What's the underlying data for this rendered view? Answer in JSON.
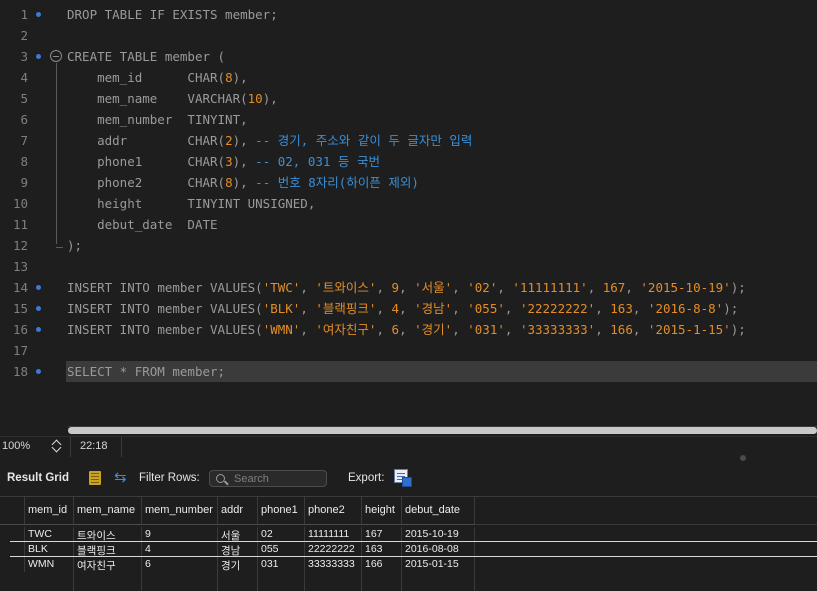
{
  "editor": {
    "lines": [
      {
        "n": "1",
        "dot": true,
        "html": [
          [
            "kw",
            "DROP TABLE IF EXISTS"
          ],
          [
            "pl",
            " member;"
          ]
        ]
      },
      {
        "n": "2",
        "dot": false,
        "html": []
      },
      {
        "n": "3",
        "dot": true,
        "fold": true,
        "html": [
          [
            "kw",
            "CREATE TABLE"
          ],
          [
            "pl",
            " member ("
          ]
        ]
      },
      {
        "n": "4",
        "dot": false,
        "html": [
          [
            "pl",
            "    mem_id      "
          ],
          [
            "ty",
            "CHAR"
          ],
          [
            "pl",
            "("
          ],
          [
            "num",
            "8"
          ],
          [
            "pl",
            "),"
          ]
        ]
      },
      {
        "n": "5",
        "dot": false,
        "html": [
          [
            "pl",
            "    mem_name    "
          ],
          [
            "ty",
            "VARCHAR"
          ],
          [
            "pl",
            "("
          ],
          [
            "num",
            "10"
          ],
          [
            "pl",
            "),"
          ]
        ]
      },
      {
        "n": "6",
        "dot": false,
        "html": [
          [
            "pl",
            "    mem_number  "
          ],
          [
            "ty",
            "TINYINT"
          ],
          [
            "pl",
            ","
          ]
        ]
      },
      {
        "n": "7",
        "dot": false,
        "html": [
          [
            "pl",
            "    addr        "
          ],
          [
            "ty",
            "CHAR"
          ],
          [
            "pl",
            "("
          ],
          [
            "num",
            "2"
          ],
          [
            "pl",
            "), "
          ],
          [
            "cm",
            "-- 경기, 주소와 같이 두 글자만 입력"
          ]
        ]
      },
      {
        "n": "8",
        "dot": false,
        "html": [
          [
            "pl",
            "    phone1      "
          ],
          [
            "ty",
            "CHAR"
          ],
          [
            "pl",
            "("
          ],
          [
            "num",
            "3"
          ],
          [
            "pl",
            "), "
          ],
          [
            "cm",
            "-- 02, 031 등 국번"
          ]
        ]
      },
      {
        "n": "9",
        "dot": false,
        "html": [
          [
            "pl",
            "    phone2      "
          ],
          [
            "ty",
            "CHAR"
          ],
          [
            "pl",
            "("
          ],
          [
            "num",
            "8"
          ],
          [
            "pl",
            "), "
          ],
          [
            "cm",
            "-- 번호 8자리(하이픈 제외)"
          ]
        ]
      },
      {
        "n": "10",
        "dot": false,
        "html": [
          [
            "pl",
            "    height      "
          ],
          [
            "ty",
            "TINYINT UNSIGNED"
          ],
          [
            "pl",
            ","
          ]
        ]
      },
      {
        "n": "11",
        "dot": false,
        "html": [
          [
            "pl",
            "    debut_date  "
          ],
          [
            "ty",
            "DATE"
          ]
        ]
      },
      {
        "n": "12",
        "dot": false,
        "foldEnd": true,
        "html": [
          [
            "pl",
            ");"
          ]
        ]
      },
      {
        "n": "13",
        "dot": false,
        "html": []
      },
      {
        "n": "14",
        "dot": true,
        "html": [
          [
            "kw",
            "INSERT INTO"
          ],
          [
            "pl",
            " member "
          ],
          [
            "kw",
            "VALUES"
          ],
          [
            "pl",
            "("
          ],
          [
            "str",
            "'TWC'"
          ],
          [
            "pl",
            ", "
          ],
          [
            "str",
            "'트와이스'"
          ],
          [
            "pl",
            ", "
          ],
          [
            "num",
            "9"
          ],
          [
            "pl",
            ", "
          ],
          [
            "str",
            "'서울'"
          ],
          [
            "pl",
            ", "
          ],
          [
            "str",
            "'02'"
          ],
          [
            "pl",
            ", "
          ],
          [
            "str",
            "'11111111'"
          ],
          [
            "pl",
            ", "
          ],
          [
            "num",
            "167"
          ],
          [
            "pl",
            ", "
          ],
          [
            "str",
            "'2015-10-19'"
          ],
          [
            "pl",
            ");"
          ]
        ]
      },
      {
        "n": "15",
        "dot": true,
        "html": [
          [
            "kw",
            "INSERT INTO"
          ],
          [
            "pl",
            " member "
          ],
          [
            "kw",
            "VALUES"
          ],
          [
            "pl",
            "("
          ],
          [
            "str",
            "'BLK'"
          ],
          [
            "pl",
            ", "
          ],
          [
            "str",
            "'블랙핑크'"
          ],
          [
            "pl",
            ", "
          ],
          [
            "num",
            "4"
          ],
          [
            "pl",
            ", "
          ],
          [
            "str",
            "'경남'"
          ],
          [
            "pl",
            ", "
          ],
          [
            "str",
            "'055'"
          ],
          [
            "pl",
            ", "
          ],
          [
            "str",
            "'22222222'"
          ],
          [
            "pl",
            ", "
          ],
          [
            "num",
            "163"
          ],
          [
            "pl",
            ", "
          ],
          [
            "str",
            "'2016-8-8'"
          ],
          [
            "pl",
            ");"
          ]
        ]
      },
      {
        "n": "16",
        "dot": true,
        "html": [
          [
            "kw",
            "INSERT INTO"
          ],
          [
            "pl",
            " member "
          ],
          [
            "kw",
            "VALUES"
          ],
          [
            "pl",
            "("
          ],
          [
            "str",
            "'WMN'"
          ],
          [
            "pl",
            ", "
          ],
          [
            "str",
            "'여자친구'"
          ],
          [
            "pl",
            ", "
          ],
          [
            "num",
            "6"
          ],
          [
            "pl",
            ", "
          ],
          [
            "str",
            "'경기'"
          ],
          [
            "pl",
            ", "
          ],
          [
            "str",
            "'031'"
          ],
          [
            "pl",
            ", "
          ],
          [
            "str",
            "'33333333'"
          ],
          [
            "pl",
            ", "
          ],
          [
            "num",
            "166"
          ],
          [
            "pl",
            ", "
          ],
          [
            "str",
            "'2015-1-15'"
          ],
          [
            "pl",
            ");"
          ]
        ]
      },
      {
        "n": "17",
        "dot": false,
        "html": []
      },
      {
        "n": "18",
        "dot": true,
        "current": true,
        "html": [
          [
            "kw",
            "SELECT"
          ],
          [
            "pl",
            " * "
          ],
          [
            "kw",
            "FROM"
          ],
          [
            "pl",
            " member;"
          ]
        ]
      }
    ]
  },
  "status": {
    "zoom": "100%",
    "cursor": "22:18"
  },
  "result_toolbar": {
    "result_grid_label": "Result Grid",
    "filter_rows_label": "Filter Rows:",
    "search_placeholder": "Search",
    "export_label": "Export:"
  },
  "grid": {
    "columns": [
      "mem_id",
      "mem_name",
      "mem_number",
      "addr",
      "phone1",
      "phone2",
      "height",
      "debut_date"
    ],
    "rows": [
      [
        "TWC",
        "트와이스",
        "9",
        "서울",
        "02",
        "11111111",
        "167",
        "2015-10-19"
      ],
      [
        "BLK",
        "블랙핑크",
        "4",
        "경남",
        "055",
        "22222222",
        "163",
        "2016-08-08"
      ],
      [
        "WMN",
        "여자친구",
        "6",
        "경기",
        "031",
        "33333333",
        "166",
        "2015-01-15"
      ]
    ]
  },
  "colors": {
    "keyword": "#9a9a9a",
    "literal": "#e38d27",
    "comment": "#3a8fd8",
    "breakpoint_dot": "#3e78d8",
    "current_line": "#3b3b3b"
  }
}
